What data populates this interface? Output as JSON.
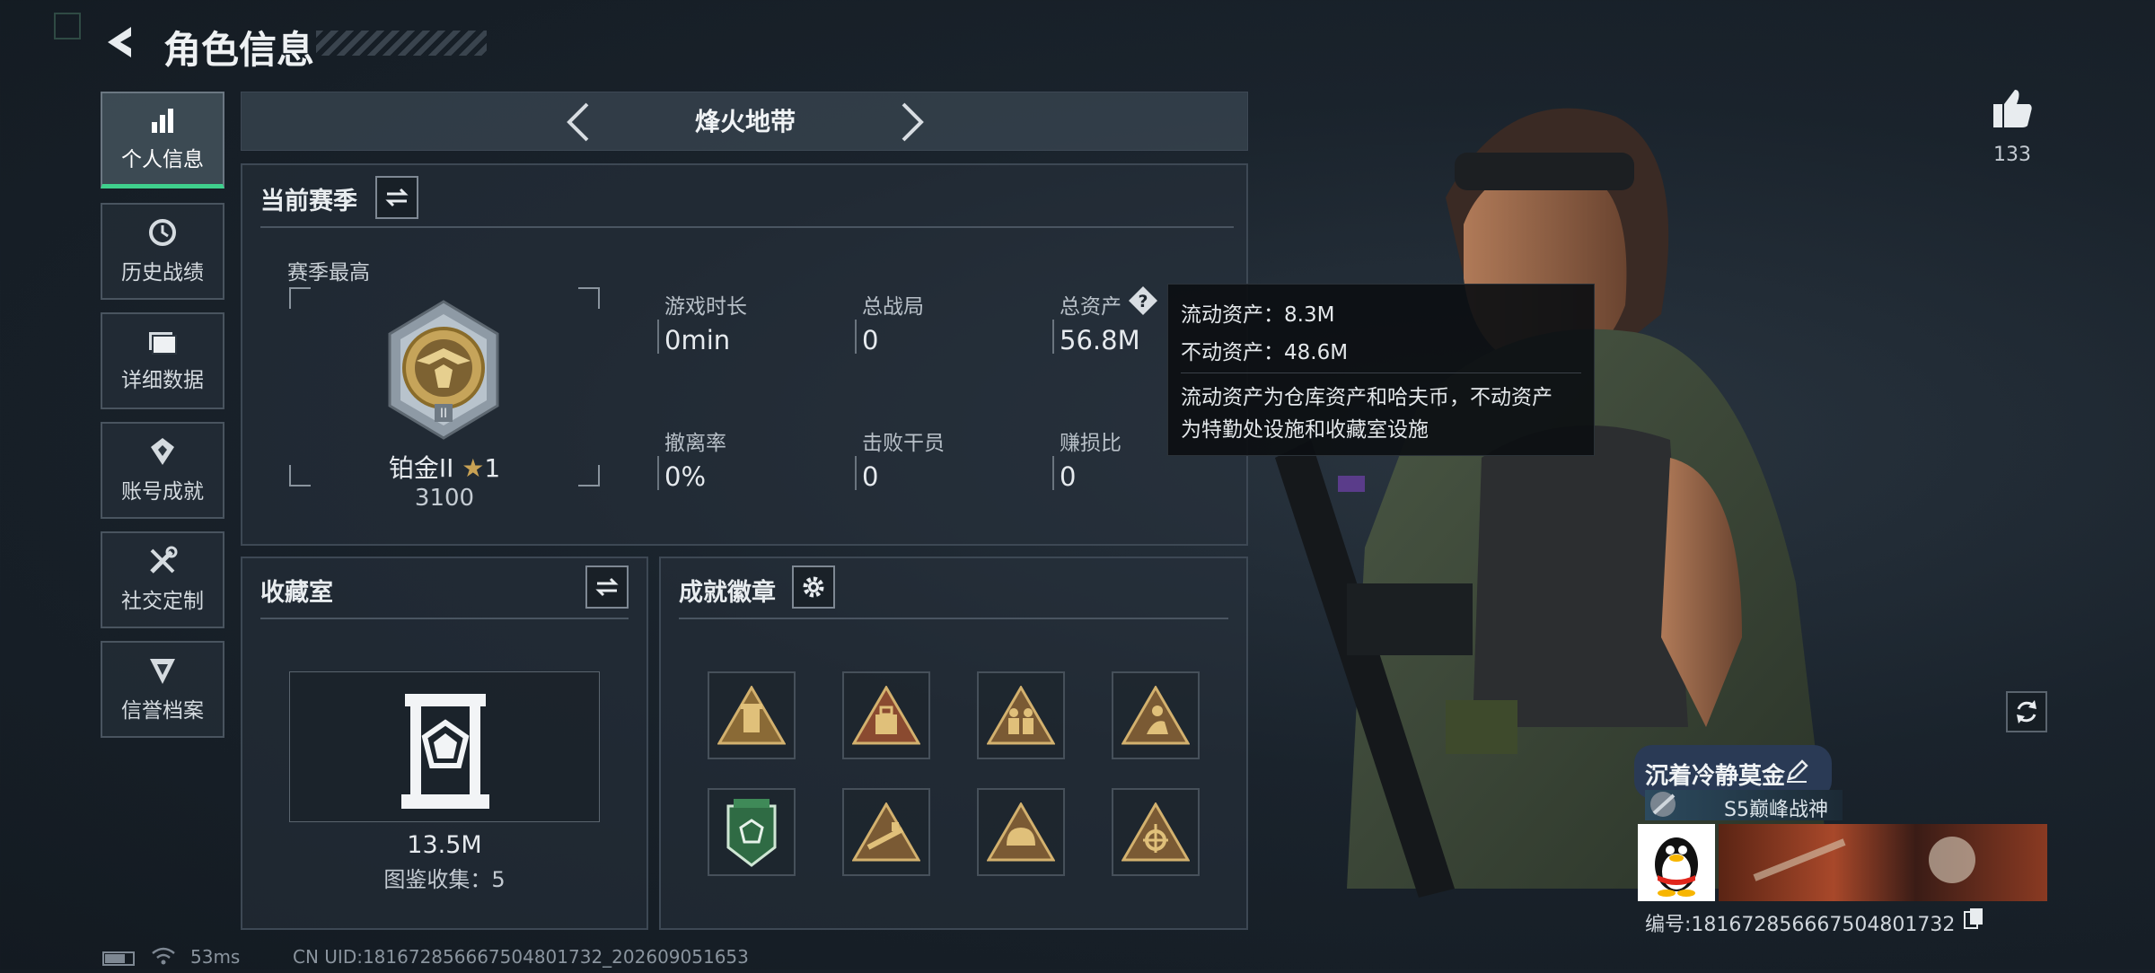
{
  "header": {
    "title": "角色信息"
  },
  "sidebar": {
    "items": [
      {
        "label": "个人信息",
        "icon": "bar-chart-icon",
        "active": true
      },
      {
        "label": "历史战绩",
        "icon": "history-icon"
      },
      {
        "label": "详细数据",
        "icon": "folder-icon"
      },
      {
        "label": "账号成就",
        "icon": "achievement-icon"
      },
      {
        "label": "社交定制",
        "icon": "tools-icon"
      },
      {
        "label": "信誉档案",
        "icon": "credit-icon"
      }
    ]
  },
  "mode_selector": {
    "label": "烽火地带"
  },
  "season": {
    "title": "当前赛季",
    "best_label": "赛季最高",
    "rank_name": "铂金II",
    "rank_stars": "1",
    "rank_score": "3100",
    "stats": [
      {
        "label": "游戏时长",
        "value": "0min"
      },
      {
        "label": "总战局",
        "value": "0"
      },
      {
        "label": "总资产",
        "value": "56.8M"
      },
      {
        "label": "撤离率",
        "value": "0%"
      },
      {
        "label": "击败干员",
        "value": "0"
      },
      {
        "label": "赚损比",
        "value": "0"
      }
    ]
  },
  "tooltip": {
    "line1": "流动资产：8.3M",
    "line2": "不动资产：48.6M",
    "desc1": "流动资产为仓库资产和哈夫币，不动资产",
    "desc2": "为特勤处设施和收藏室设施"
  },
  "collection": {
    "title": "收藏室",
    "value": "13.5M",
    "count_label": "图鉴收集：5"
  },
  "badges": {
    "title": "成就徽章",
    "items": [
      "badge-1",
      "badge-2",
      "badge-3",
      "badge-4",
      "badge-5",
      "badge-6",
      "badge-7",
      "badge-8"
    ]
  },
  "profile": {
    "likes": "133",
    "name": "沉着冷静莫金",
    "title_badge": "S5巅峰战神",
    "id_label": "编号:1816728566675048017​32",
    "id": "编号:18167285666750480173​2"
  },
  "status": {
    "ping": "53ms",
    "uid": "CN UID:181672856667504801732_202609051653"
  },
  "colors": {
    "accent": "#3fd08d",
    "gold": "#c9a254",
    "panel_border": "#3d4854"
  }
}
